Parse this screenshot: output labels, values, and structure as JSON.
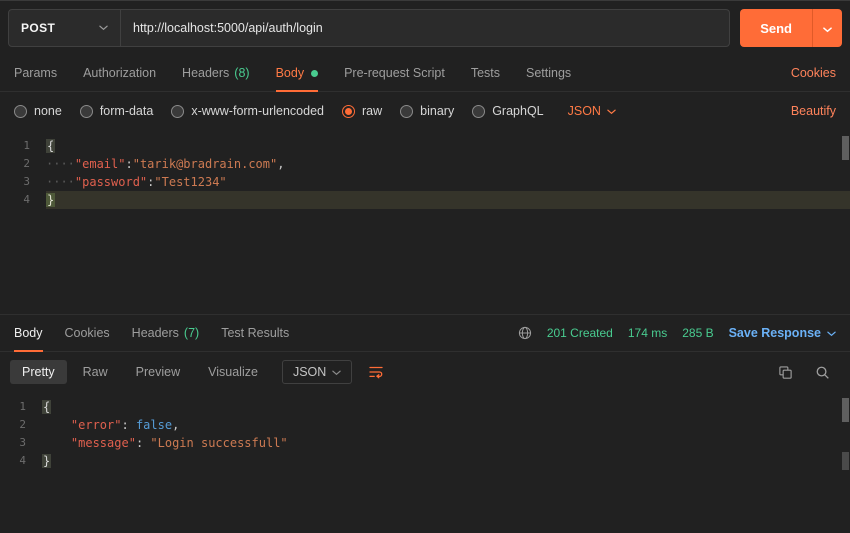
{
  "colors": {
    "accent_orange": "#ff6c37",
    "status_green": "#49cc90",
    "link_blue": "#6bb1f6"
  },
  "request": {
    "method": "POST",
    "url": "http://localhost:5000/api/auth/login",
    "send_label": "Send",
    "cookies_link": "Cookies",
    "tabs": [
      {
        "label": "Params"
      },
      {
        "label": "Authorization"
      },
      {
        "label": "Headers",
        "count": "(8)"
      },
      {
        "label": "Body",
        "active": true
      },
      {
        "label": "Pre-request Script"
      },
      {
        "label": "Tests"
      },
      {
        "label": "Settings"
      }
    ],
    "body_types": [
      {
        "label": "none",
        "selected": false
      },
      {
        "label": "form-data",
        "selected": false
      },
      {
        "label": "x-www-form-urlencoded",
        "selected": false
      },
      {
        "label": "raw",
        "selected": true
      },
      {
        "label": "binary",
        "selected": false
      },
      {
        "label": "GraphQL",
        "selected": false
      }
    ],
    "raw_format": "JSON",
    "beautify_link": "Beautify",
    "code_lines": [
      {
        "num": "1",
        "tokens": [
          {
            "t": "brkt",
            "v": "{"
          }
        ]
      },
      {
        "num": "2",
        "tokens": [
          {
            "t": "ws",
            "v": "····"
          },
          {
            "t": "key",
            "v": "\"email\""
          },
          {
            "t": "punc",
            "v": ":"
          },
          {
            "t": "str",
            "v": "\"tarik@bradrain.com\""
          },
          {
            "t": "punc",
            "v": ","
          }
        ]
      },
      {
        "num": "3",
        "tokens": [
          {
            "t": "ws",
            "v": "····"
          },
          {
            "t": "key",
            "v": "\"password\""
          },
          {
            "t": "punc",
            "v": ":"
          },
          {
            "t": "str",
            "v": "\"Test1234\""
          }
        ]
      },
      {
        "num": "4",
        "highlight": true,
        "tokens": [
          {
            "t": "brkt2",
            "v": "}"
          }
        ]
      }
    ]
  },
  "response": {
    "tabs": [
      {
        "label": "Body",
        "active": true
      },
      {
        "label": "Cookies"
      },
      {
        "label": "Headers",
        "count": "(7)"
      },
      {
        "label": "Test Results"
      }
    ],
    "status": "201 Created",
    "time": "174 ms",
    "size": "285 B",
    "save_label": "Save Response",
    "view_tabs": [
      {
        "label": "Pretty",
        "active": true
      },
      {
        "label": "Raw"
      },
      {
        "label": "Preview"
      },
      {
        "label": "Visualize"
      }
    ],
    "format": "JSON",
    "code_lines": [
      {
        "num": "1",
        "tokens": [
          {
            "t": "brkt",
            "v": "{"
          }
        ]
      },
      {
        "num": "2",
        "tokens": [
          {
            "t": "sp",
            "v": "    "
          },
          {
            "t": "key",
            "v": "\"error\""
          },
          {
            "t": "punc",
            "v": ": "
          },
          {
            "t": "bool",
            "v": "false"
          },
          {
            "t": "punc",
            "v": ","
          }
        ]
      },
      {
        "num": "3",
        "tokens": [
          {
            "t": "sp",
            "v": "    "
          },
          {
            "t": "key",
            "v": "\"message\""
          },
          {
            "t": "punc",
            "v": ": "
          },
          {
            "t": "str",
            "v": "\"Login successfull\""
          }
        ]
      },
      {
        "num": "4",
        "tokens": [
          {
            "t": "brkt",
            "v": "}"
          }
        ]
      }
    ]
  }
}
